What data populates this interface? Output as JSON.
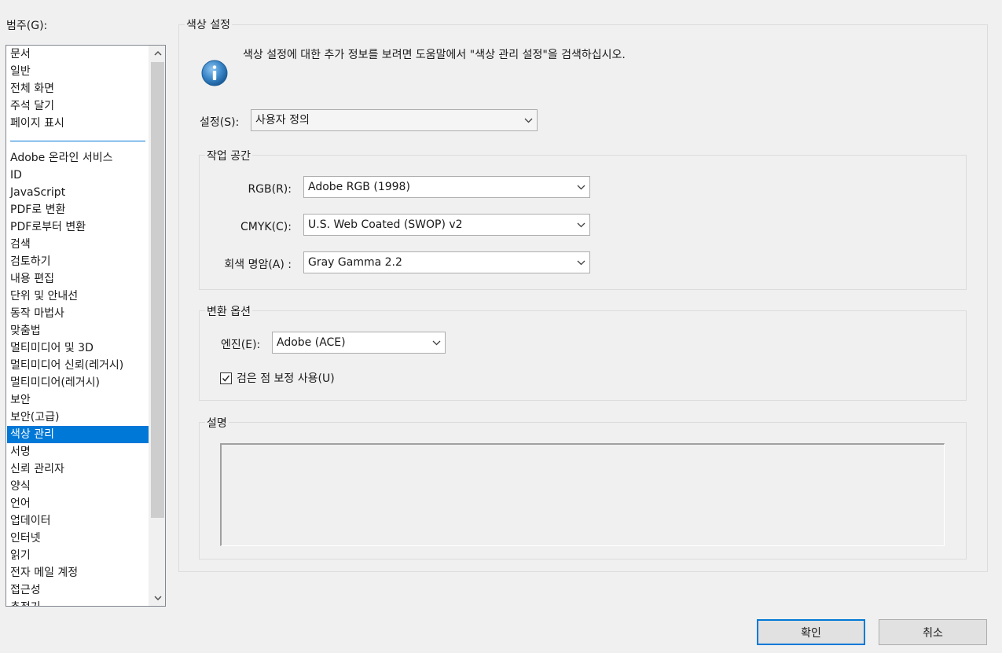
{
  "category": {
    "label": "범주(G):",
    "items": [
      "문서",
      "일반",
      "전체 화면",
      "주석 달기",
      "페이지 표시",
      "Adobe 온라인 서비스",
      "ID",
      "JavaScript",
      "PDF로 변환",
      "PDF로부터 변환",
      "검색",
      "검토하기",
      "내용 편집",
      "단위 및 안내선",
      "동작 마법사",
      "맞춤법",
      "멀티미디어 및 3D",
      "멀티미디어 신뢰(레거시)",
      "멀티미디어(레거시)",
      "보안",
      "보안(고급)",
      "색상 관리",
      "서명",
      "신뢰 관리자",
      "양식",
      "언어",
      "업데이터",
      "인터넷",
      "읽기",
      "전자 메일 계정",
      "접근성",
      "추적기"
    ],
    "selected": "색상 관리"
  },
  "color_settings": {
    "title": "색상 설정",
    "info_text": "색상 설정에 대한 추가 정보를 보려면 도움말에서 \"색상 관리 설정\"을 검색하십시오.",
    "settings_label": "설정(S):",
    "settings_value": "사용자 정의"
  },
  "workspace": {
    "title": "작업 공간",
    "rgb_label": "RGB(R):",
    "rgb_value": "Adobe RGB (1998)",
    "cmyk_label": "CMYK(C):",
    "cmyk_value": "U.S. Web Coated (SWOP) v2",
    "gray_label": "회색 명암(A) :",
    "gray_value": "Gray Gamma 2.2"
  },
  "conversion": {
    "title": "변환 옵션",
    "engine_label": "엔진(E):",
    "engine_value": "Adobe (ACE)",
    "blackpoint_label": "검은 점 보정 사용(U)",
    "blackpoint_checked": true
  },
  "description": {
    "title": "설명",
    "text": ""
  },
  "buttons": {
    "ok": "확인",
    "cancel": "취소"
  },
  "colors": {
    "selection": "#0078d7",
    "background": "#f0f0f0"
  }
}
